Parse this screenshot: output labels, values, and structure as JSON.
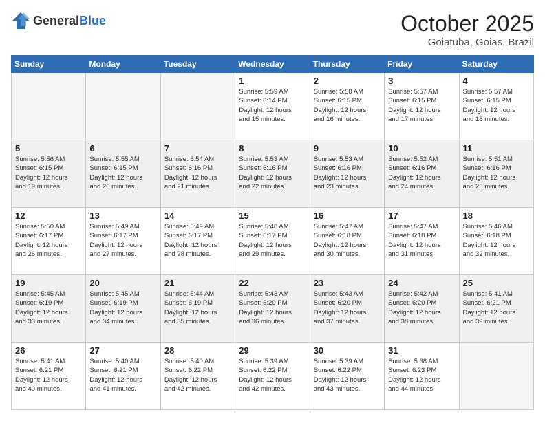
{
  "logo": {
    "general": "General",
    "blue": "Blue"
  },
  "header": {
    "month": "October 2025",
    "location": "Goiatuba, Goias, Brazil"
  },
  "weekdays": [
    "Sunday",
    "Monday",
    "Tuesday",
    "Wednesday",
    "Thursday",
    "Friday",
    "Saturday"
  ],
  "weeks": [
    [
      {
        "day": "",
        "info": ""
      },
      {
        "day": "",
        "info": ""
      },
      {
        "day": "",
        "info": ""
      },
      {
        "day": "1",
        "info": "Sunrise: 5:59 AM\nSunset: 6:14 PM\nDaylight: 12 hours\nand 15 minutes."
      },
      {
        "day": "2",
        "info": "Sunrise: 5:58 AM\nSunset: 6:15 PM\nDaylight: 12 hours\nand 16 minutes."
      },
      {
        "day": "3",
        "info": "Sunrise: 5:57 AM\nSunset: 6:15 PM\nDaylight: 12 hours\nand 17 minutes."
      },
      {
        "day": "4",
        "info": "Sunrise: 5:57 AM\nSunset: 6:15 PM\nDaylight: 12 hours\nand 18 minutes."
      }
    ],
    [
      {
        "day": "5",
        "info": "Sunrise: 5:56 AM\nSunset: 6:15 PM\nDaylight: 12 hours\nand 19 minutes."
      },
      {
        "day": "6",
        "info": "Sunrise: 5:55 AM\nSunset: 6:15 PM\nDaylight: 12 hours\nand 20 minutes."
      },
      {
        "day": "7",
        "info": "Sunrise: 5:54 AM\nSunset: 6:16 PM\nDaylight: 12 hours\nand 21 minutes."
      },
      {
        "day": "8",
        "info": "Sunrise: 5:53 AM\nSunset: 6:16 PM\nDaylight: 12 hours\nand 22 minutes."
      },
      {
        "day": "9",
        "info": "Sunrise: 5:53 AM\nSunset: 6:16 PM\nDaylight: 12 hours\nand 23 minutes."
      },
      {
        "day": "10",
        "info": "Sunrise: 5:52 AM\nSunset: 6:16 PM\nDaylight: 12 hours\nand 24 minutes."
      },
      {
        "day": "11",
        "info": "Sunrise: 5:51 AM\nSunset: 6:16 PM\nDaylight: 12 hours\nand 25 minutes."
      }
    ],
    [
      {
        "day": "12",
        "info": "Sunrise: 5:50 AM\nSunset: 6:17 PM\nDaylight: 12 hours\nand 26 minutes."
      },
      {
        "day": "13",
        "info": "Sunrise: 5:49 AM\nSunset: 6:17 PM\nDaylight: 12 hours\nand 27 minutes."
      },
      {
        "day": "14",
        "info": "Sunrise: 5:49 AM\nSunset: 6:17 PM\nDaylight: 12 hours\nand 28 minutes."
      },
      {
        "day": "15",
        "info": "Sunrise: 5:48 AM\nSunset: 6:17 PM\nDaylight: 12 hours\nand 29 minutes."
      },
      {
        "day": "16",
        "info": "Sunrise: 5:47 AM\nSunset: 6:18 PM\nDaylight: 12 hours\nand 30 minutes."
      },
      {
        "day": "17",
        "info": "Sunrise: 5:47 AM\nSunset: 6:18 PM\nDaylight: 12 hours\nand 31 minutes."
      },
      {
        "day": "18",
        "info": "Sunrise: 5:46 AM\nSunset: 6:18 PM\nDaylight: 12 hours\nand 32 minutes."
      }
    ],
    [
      {
        "day": "19",
        "info": "Sunrise: 5:45 AM\nSunset: 6:19 PM\nDaylight: 12 hours\nand 33 minutes."
      },
      {
        "day": "20",
        "info": "Sunrise: 5:45 AM\nSunset: 6:19 PM\nDaylight: 12 hours\nand 34 minutes."
      },
      {
        "day": "21",
        "info": "Sunrise: 5:44 AM\nSunset: 6:19 PM\nDaylight: 12 hours\nand 35 minutes."
      },
      {
        "day": "22",
        "info": "Sunrise: 5:43 AM\nSunset: 6:20 PM\nDaylight: 12 hours\nand 36 minutes."
      },
      {
        "day": "23",
        "info": "Sunrise: 5:43 AM\nSunset: 6:20 PM\nDaylight: 12 hours\nand 37 minutes."
      },
      {
        "day": "24",
        "info": "Sunrise: 5:42 AM\nSunset: 6:20 PM\nDaylight: 12 hours\nand 38 minutes."
      },
      {
        "day": "25",
        "info": "Sunrise: 5:41 AM\nSunset: 6:21 PM\nDaylight: 12 hours\nand 39 minutes."
      }
    ],
    [
      {
        "day": "26",
        "info": "Sunrise: 5:41 AM\nSunset: 6:21 PM\nDaylight: 12 hours\nand 40 minutes."
      },
      {
        "day": "27",
        "info": "Sunrise: 5:40 AM\nSunset: 6:21 PM\nDaylight: 12 hours\nand 41 minutes."
      },
      {
        "day": "28",
        "info": "Sunrise: 5:40 AM\nSunset: 6:22 PM\nDaylight: 12 hours\nand 42 minutes."
      },
      {
        "day": "29",
        "info": "Sunrise: 5:39 AM\nSunset: 6:22 PM\nDaylight: 12 hours\nand 42 minutes."
      },
      {
        "day": "30",
        "info": "Sunrise: 5:39 AM\nSunset: 6:22 PM\nDaylight: 12 hours\nand 43 minutes."
      },
      {
        "day": "31",
        "info": "Sunrise: 5:38 AM\nSunset: 6:23 PM\nDaylight: 12 hours\nand 44 minutes."
      },
      {
        "day": "",
        "info": ""
      }
    ]
  ]
}
